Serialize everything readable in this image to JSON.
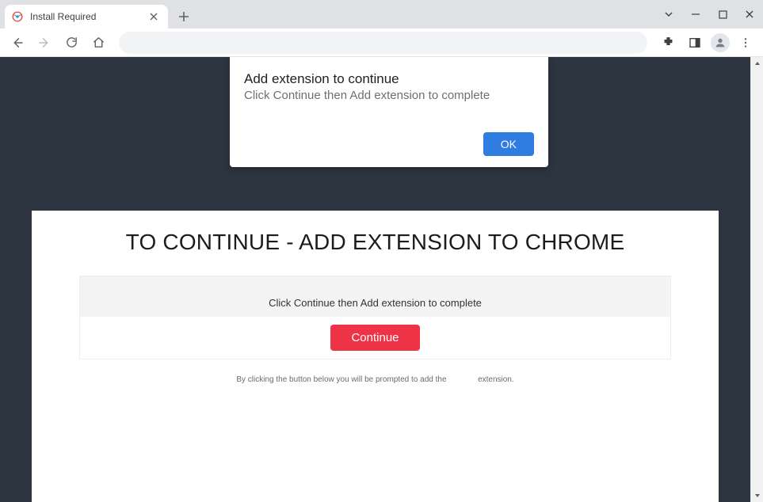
{
  "tab": {
    "title": "Install Required"
  },
  "dialog": {
    "title": "Add extension to continue",
    "subtitle": "Click Continue then Add extension to complete",
    "ok": "OK"
  },
  "page": {
    "heading": "TO CONTINUE - ADD EXTENSION TO CHROME",
    "instruction": "Click Continue then Add extension to complete",
    "continue": "Continue",
    "fine_a": "By clicking the button below you will be prompted to add the",
    "fine_b": "extension."
  }
}
